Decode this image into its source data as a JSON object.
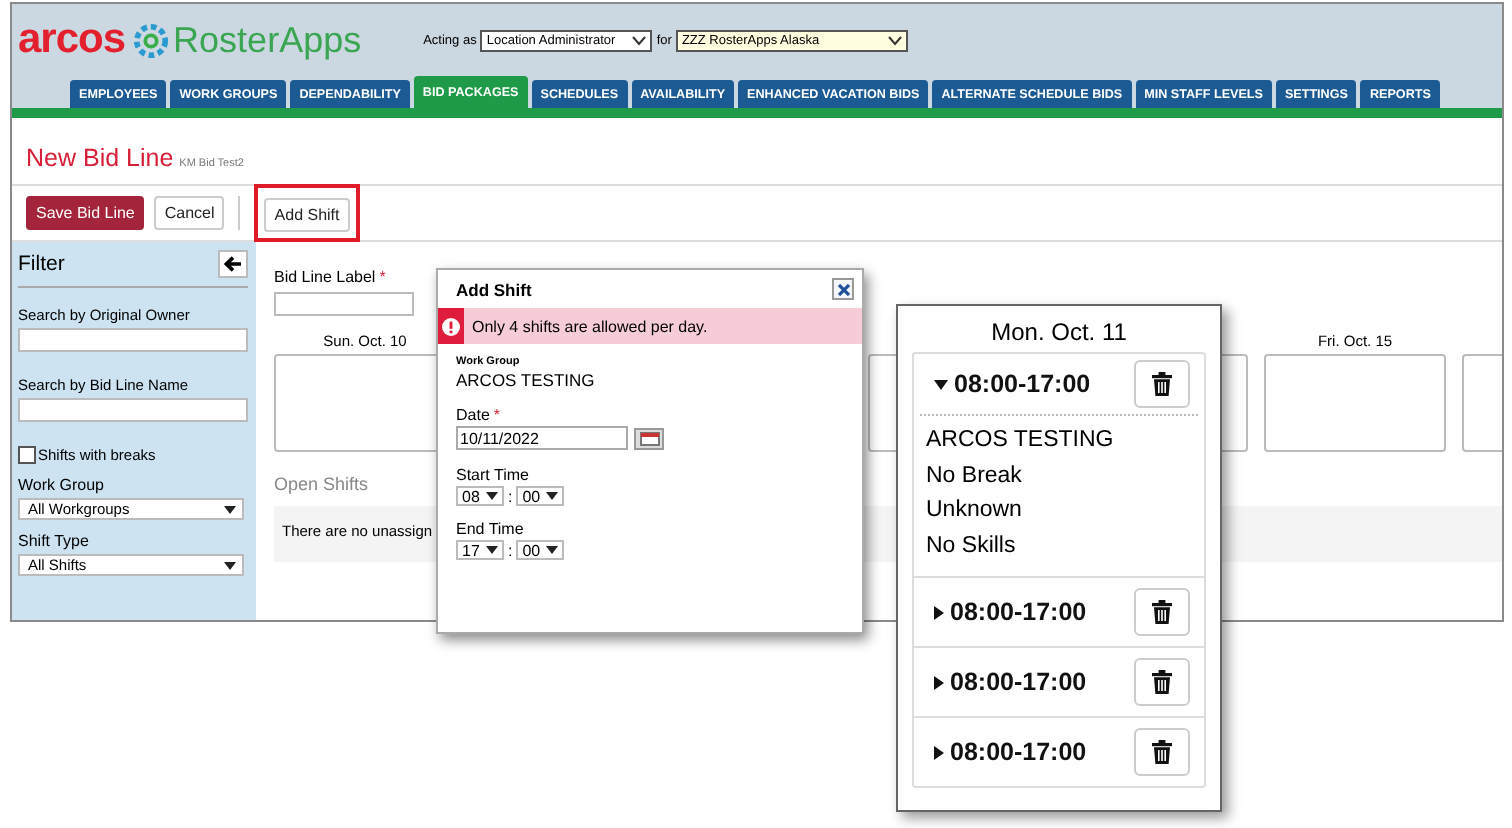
{
  "header": {
    "logo_brand": "arcos",
    "logo_product": "RosterApps",
    "acting_as_label": "Acting as",
    "role": "Location Administrator",
    "for_label": "for",
    "location": "ZZZ RosterApps Alaska"
  },
  "tabs": [
    {
      "label": "EMPLOYEES",
      "selected": false
    },
    {
      "label": "WORK GROUPS",
      "selected": false
    },
    {
      "label": "DEPENDABILITY",
      "selected": false
    },
    {
      "label": "BID PACKAGES",
      "selected": true
    },
    {
      "label": "SCHEDULES",
      "selected": false
    },
    {
      "label": "AVAILABILITY",
      "selected": false
    },
    {
      "label": "ENHANCED VACATION BIDS",
      "selected": false
    },
    {
      "label": "ALTERNATE SCHEDULE BIDS",
      "selected": false
    },
    {
      "label": "MIN STAFF LEVELS",
      "selected": false
    },
    {
      "label": "SETTINGS",
      "selected": false
    },
    {
      "label": "REPORTS",
      "selected": false
    }
  ],
  "page": {
    "title": "New Bid Line",
    "subtitle": "KM Bid Test2"
  },
  "toolbar": {
    "save": "Save Bid Line",
    "cancel": "Cancel",
    "add_shift": "Add Shift"
  },
  "filter": {
    "title": "Filter",
    "original_owner_label": "Search by Original Owner",
    "bid_line_name_label": "Search by Bid Line Name",
    "shifts_with_breaks": {
      "label": "Shifts with breaks",
      "checked": false
    },
    "work_group_label": "Work Group",
    "work_group": "All Workgroups",
    "shift_type_label": "Shift Type",
    "shift_type": "All Shifts"
  },
  "bid_line": {
    "label": "Bid Line Label",
    "required_mark": "*",
    "days": [
      {
        "label": "Sun. Oct. 10"
      },
      {
        "label": "Fri. Oct. 15"
      }
    ],
    "open_shifts_title": "Open Shifts",
    "open_shifts_message": "There are no unassign"
  },
  "dialog": {
    "title": "Add Shift",
    "alert": "Only 4 shifts are allowed per day.",
    "work_group_label": "Work Group",
    "work_group": "ARCOS TESTING",
    "date_label": "Date",
    "required_mark": "*",
    "date": "10/11/2022",
    "start_label": "Start Time",
    "start_hour": "08",
    "start_minute": "00",
    "end_label": "End Time",
    "end_hour": "17",
    "end_minute": "00",
    "separator": ":"
  },
  "day_detail": {
    "title": "Mon. Oct. 11",
    "shifts": [
      {
        "time": "08:00-17:00",
        "expanded": true,
        "details": [
          "ARCOS TESTING",
          "No Break",
          "Unknown",
          "No Skills"
        ]
      },
      {
        "time": "08:00-17:00",
        "expanded": false
      },
      {
        "time": "08:00-17:00",
        "expanded": false
      },
      {
        "time": "08:00-17:00",
        "expanded": false
      }
    ]
  }
}
